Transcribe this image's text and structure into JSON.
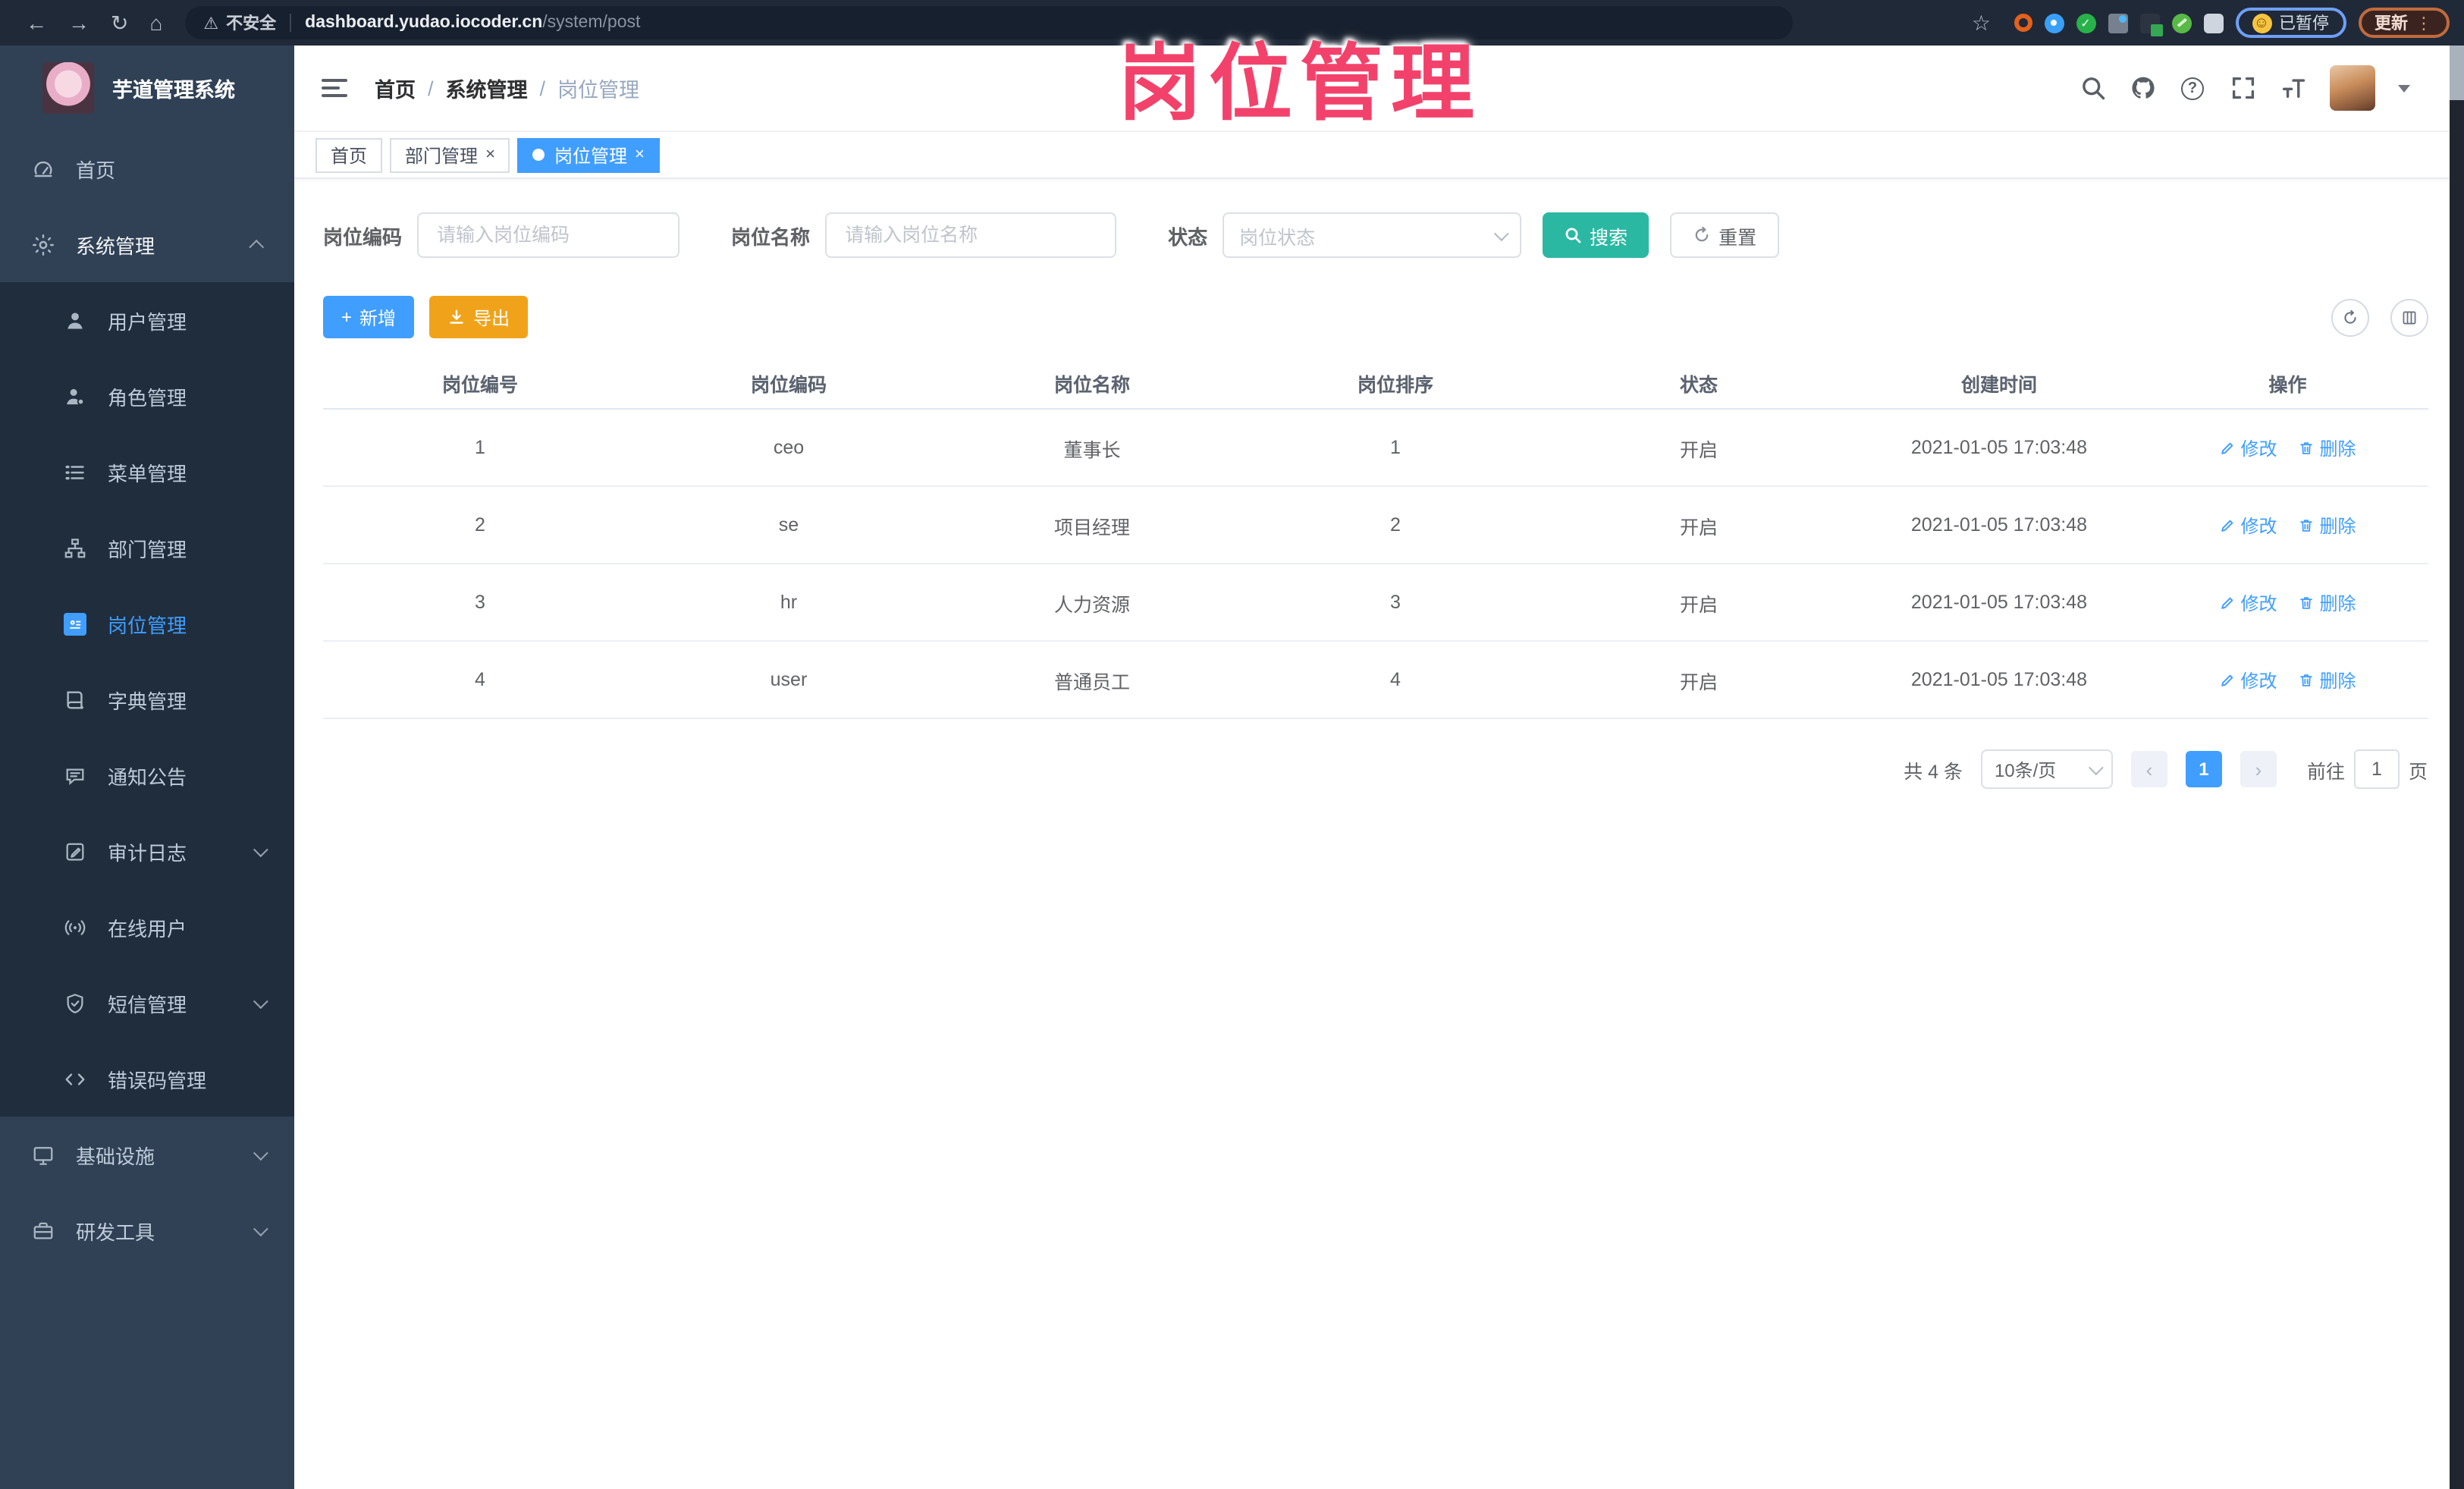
{
  "browser": {
    "security_label": "不安全",
    "url_host": "dashboard.yudao.iocoder.cn",
    "url_path": "/system/post",
    "paused_badge": "已暂停",
    "update_label": "更新"
  },
  "glyphs": {
    "back": "←",
    "forward": "→",
    "reload": "↻",
    "home": "⌂",
    "warning": "⚠",
    "star": "☆",
    "menu_dots": "⋮",
    "smile": "☺",
    "close": "×",
    "prev": "‹",
    "next": "›",
    "plus": "+",
    "question": "?",
    "divider": "/"
  },
  "annotation": {
    "text": "岗位管理"
  },
  "sidebar": {
    "title": "芋道管理系统",
    "items": [
      {
        "label": "首页",
        "level": 1
      },
      {
        "label": "系统管理",
        "level": 1,
        "expanded": true
      },
      {
        "label": "用户管理",
        "level": 2
      },
      {
        "label": "角色管理",
        "level": 2
      },
      {
        "label": "菜单管理",
        "level": 2
      },
      {
        "label": "部门管理",
        "level": 2
      },
      {
        "label": "岗位管理",
        "level": 2,
        "active": true
      },
      {
        "label": "字典管理",
        "level": 2
      },
      {
        "label": "通知公告",
        "level": 2
      },
      {
        "label": "审计日志",
        "level": 2,
        "collapsible": true
      },
      {
        "label": "在线用户",
        "level": 2
      },
      {
        "label": "短信管理",
        "level": 2,
        "collapsible": true
      },
      {
        "label": "错误码管理",
        "level": 2
      },
      {
        "label": "基础设施",
        "level": 1,
        "collapsible": true
      },
      {
        "label": "研发工具",
        "level": 1,
        "collapsible": true
      }
    ]
  },
  "header": {
    "breadcrumb": [
      "首页",
      "系统管理",
      "岗位管理"
    ]
  },
  "tabs": {
    "items": [
      {
        "label": "首页"
      },
      {
        "label": "部门管理"
      },
      {
        "label": "岗位管理"
      }
    ]
  },
  "filters": {
    "code_label": "岗位编码",
    "code_placeholder": "请输入岗位编码",
    "name_label": "岗位名称",
    "name_placeholder": "请输入岗位名称",
    "status_label": "状态",
    "status_placeholder": "岗位状态",
    "search_label": "搜索",
    "reset_label": "重置"
  },
  "toolbar": {
    "add_label": "新增",
    "export_label": "导出"
  },
  "table": {
    "columns": [
      "岗位编号",
      "岗位编码",
      "岗位名称",
      "岗位排序",
      "状态",
      "创建时间",
      "操作"
    ],
    "rows": [
      {
        "id": "1",
        "code": "ceo",
        "name": "董事长",
        "sort": "1",
        "status": "开启",
        "created": "2021-01-05 17:03:48"
      },
      {
        "id": "2",
        "code": "se",
        "name": "项目经理",
        "sort": "2",
        "status": "开启",
        "created": "2021-01-05 17:03:48"
      },
      {
        "id": "3",
        "code": "hr",
        "name": "人力资源",
        "sort": "3",
        "status": "开启",
        "created": "2021-01-05 17:03:48"
      },
      {
        "id": "4",
        "code": "user",
        "name": "普通员工",
        "sort": "4",
        "status": "开启",
        "created": "2021-01-05 17:03:48"
      }
    ],
    "actions": {
      "edit": "修改",
      "delete": "删除"
    }
  },
  "pagination": {
    "total": "共 4 条",
    "page_size": "10条/页",
    "current_page": "1",
    "goto_label": "前往",
    "goto_value": "1",
    "goto_suffix": "页"
  },
  "colors": {
    "accent": "#409eff",
    "teal": "#2bb8a3",
    "warning": "#f0a31a",
    "annotation": "#f2426b",
    "sidebar": "#304156",
    "sidebar_sub": "#1f2d3d",
    "chrome": "#202938"
  }
}
